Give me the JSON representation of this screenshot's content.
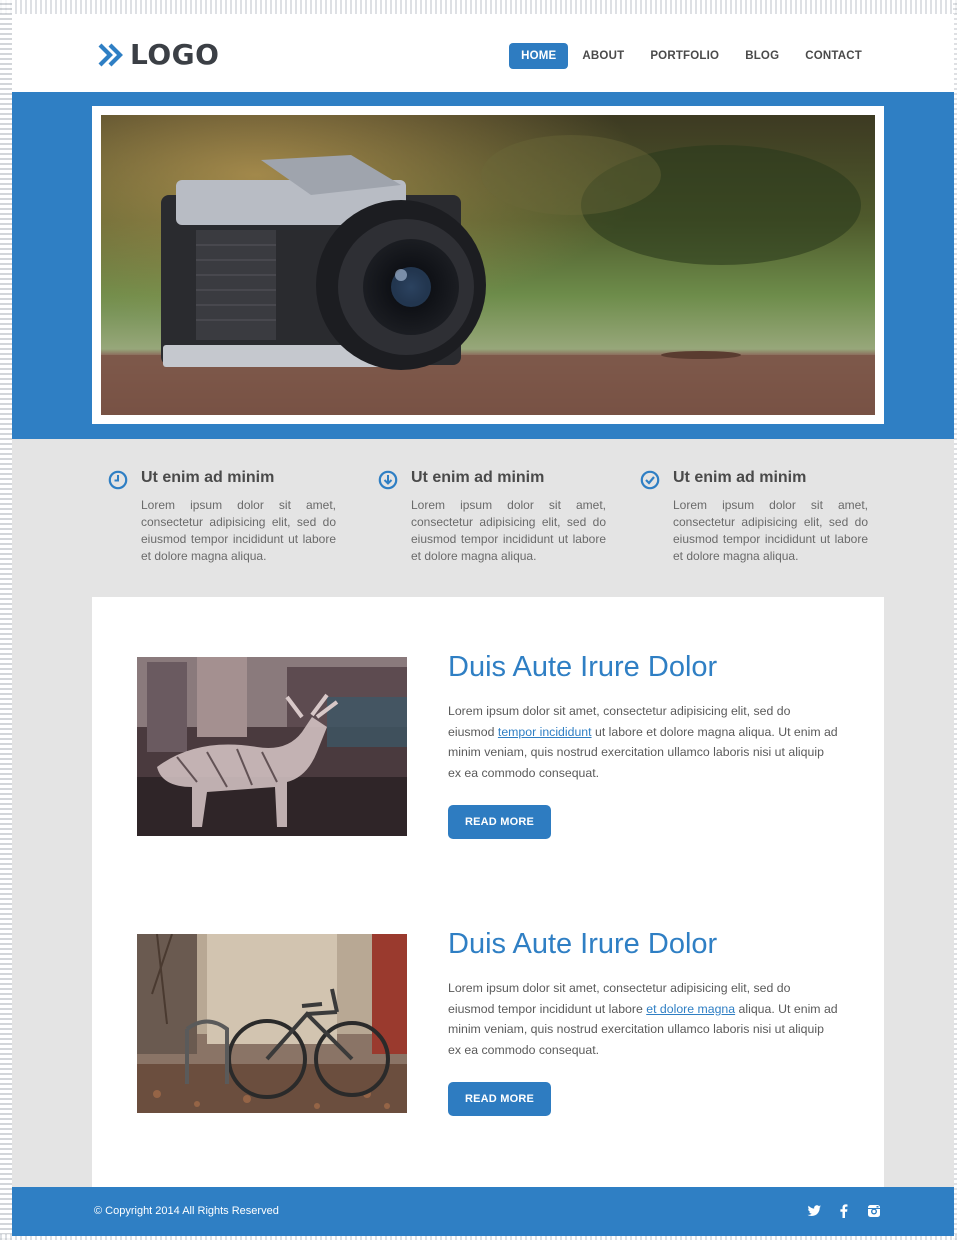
{
  "logo": {
    "text": "LOGO"
  },
  "nav": {
    "items": [
      {
        "label": "HOME"
      },
      {
        "label": "ABOUT"
      },
      {
        "label": "PORTFOLIO"
      },
      {
        "label": "BLOG"
      },
      {
        "label": "CONTACT"
      }
    ],
    "active": "HOME"
  },
  "colors": {
    "accent": "#2f7fc4",
    "light_bg": "#e4e4e4",
    "heading": "#4a4a4a"
  },
  "features": [
    {
      "icon": "clock-icon",
      "title": "Ut enim ad minim",
      "text": "Lorem ipsum dolor sit amet, consectetur adipisicing elit, sed do eiusmod tempor incididunt ut labore et dolore magna aliqua."
    },
    {
      "icon": "download-circle-icon",
      "title": "Ut enim ad minim",
      "text": "Lorem ipsum dolor sit amet, consectetur adipisicing elit, sed do eiusmod tempor incididunt ut labore et dolore magna aliqua."
    },
    {
      "icon": "check-circle-icon",
      "title": "Ut enim ad minim",
      "text": "Lorem ipsum dolor sit amet, consectetur adipisicing elit, sed do eiusmod tempor incididunt ut labore et dolore magna aliqua."
    }
  ],
  "posts": [
    {
      "title": "Duis Aute Irure Dolor",
      "text_before": "Lorem ipsum dolor sit amet, consectetur adipisicing elit, sed do eiusmod ",
      "link": "tempor incididunt",
      "text_after": " ut labore et dolore magna aliqua. Ut enim ad minim veniam, quis nostrud exercitation ullamco laboris nisi ut aliquip ex ea commodo consequat.",
      "button": "READ MORE"
    },
    {
      "title": "Duis Aute Irure Dolor",
      "text_before": "Lorem ipsum dolor sit amet, consectetur adipisicing elit, sed do eiusmod tempor incididunt ut labore ",
      "link": "et dolore magna",
      "text_after": " aliqua. Ut enim ad minim veniam, quis nostrud exercitation ullamco laboris nisi ut aliquip ex ea commodo consequat.",
      "button": "READ MORE"
    }
  ],
  "footer": {
    "copyright": "© Copyright 2014 All Rights Reserved",
    "social": [
      "twitter-icon",
      "facebook-icon",
      "instagram-icon"
    ]
  }
}
